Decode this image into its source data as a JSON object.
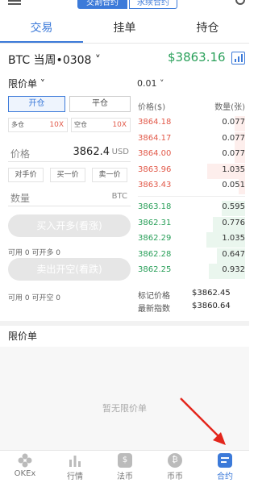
{
  "header": {
    "segment_left": "交割合约",
    "segment_right": "永续合约"
  },
  "tabs": [
    {
      "label": "交易"
    },
    {
      "label": "挂单"
    },
    {
      "label": "持仓"
    }
  ],
  "market": {
    "pair": "BTC 当周•0308 ˅",
    "last_price": "$3863.16"
  },
  "order_form": {
    "order_type": "限价单 ˅",
    "open_label": "开仓",
    "close_label": "平仓",
    "long_leverage_label": "多仓",
    "long_leverage_value": "10X",
    "short_leverage_label": "空仓",
    "short_leverage_value": "10X",
    "price_label": "价格",
    "price_value": "3862.4",
    "price_unit": "USD",
    "quick_buttons": [
      "对手价",
      "买一价",
      "卖一价"
    ],
    "qty_label": "数量",
    "qty_unit": "BTC",
    "buy_button": "买入开多(看涨)",
    "buy_avail": "可用 0  可开多 0",
    "sell_button": "卖出开空(看跌)",
    "sell_avail": "可用 0  可开空 0"
  },
  "order_book": {
    "precision": "0.01 ˅",
    "col_price": "价格($)",
    "col_amount": "数量(张)",
    "asks": [
      {
        "price": "3864.18",
        "amount": "0.077",
        "depth": 0.1
      },
      {
        "price": "3864.17",
        "amount": "0.077",
        "depth": 0.1
      },
      {
        "price": "3864.00",
        "amount": "0.077",
        "depth": 0.1
      },
      {
        "price": "3863.96",
        "amount": "1.035",
        "depth": 0.35
      },
      {
        "price": "3863.43",
        "amount": "0.051",
        "depth": 0.06
      }
    ],
    "bids": [
      {
        "price": "3863.18",
        "amount": "0.595",
        "depth": 0.22
      },
      {
        "price": "3862.31",
        "amount": "0.776",
        "depth": 0.3
      },
      {
        "price": "3862.29",
        "amount": "1.035",
        "depth": 0.36
      },
      {
        "price": "3862.28",
        "amount": "0.647",
        "depth": 0.26
      },
      {
        "price": "3862.25",
        "amount": "0.932",
        "depth": 0.34
      }
    ],
    "mark_label": "标记价格",
    "mark_value": "$3862.45",
    "index_label": "最新指数",
    "index_value": "$3860.64"
  },
  "limit_orders": {
    "title": "限价单",
    "empty_text": "暂无限价单"
  },
  "bottom_nav": [
    {
      "label": "OKEx",
      "icon": "okex-logo-icon"
    },
    {
      "label": "行情",
      "icon": "bar-chart-icon"
    },
    {
      "label": "法币",
      "icon": "fiat-icon",
      "glyph": "$"
    },
    {
      "label": "币币",
      "icon": "coin-icon",
      "glyph": "₿"
    },
    {
      "label": "合约",
      "icon": "contract-icon",
      "active": true
    }
  ],
  "colors": {
    "accent": "#3c7ad9",
    "up": "#2aa05a",
    "down": "#e25a4a"
  }
}
